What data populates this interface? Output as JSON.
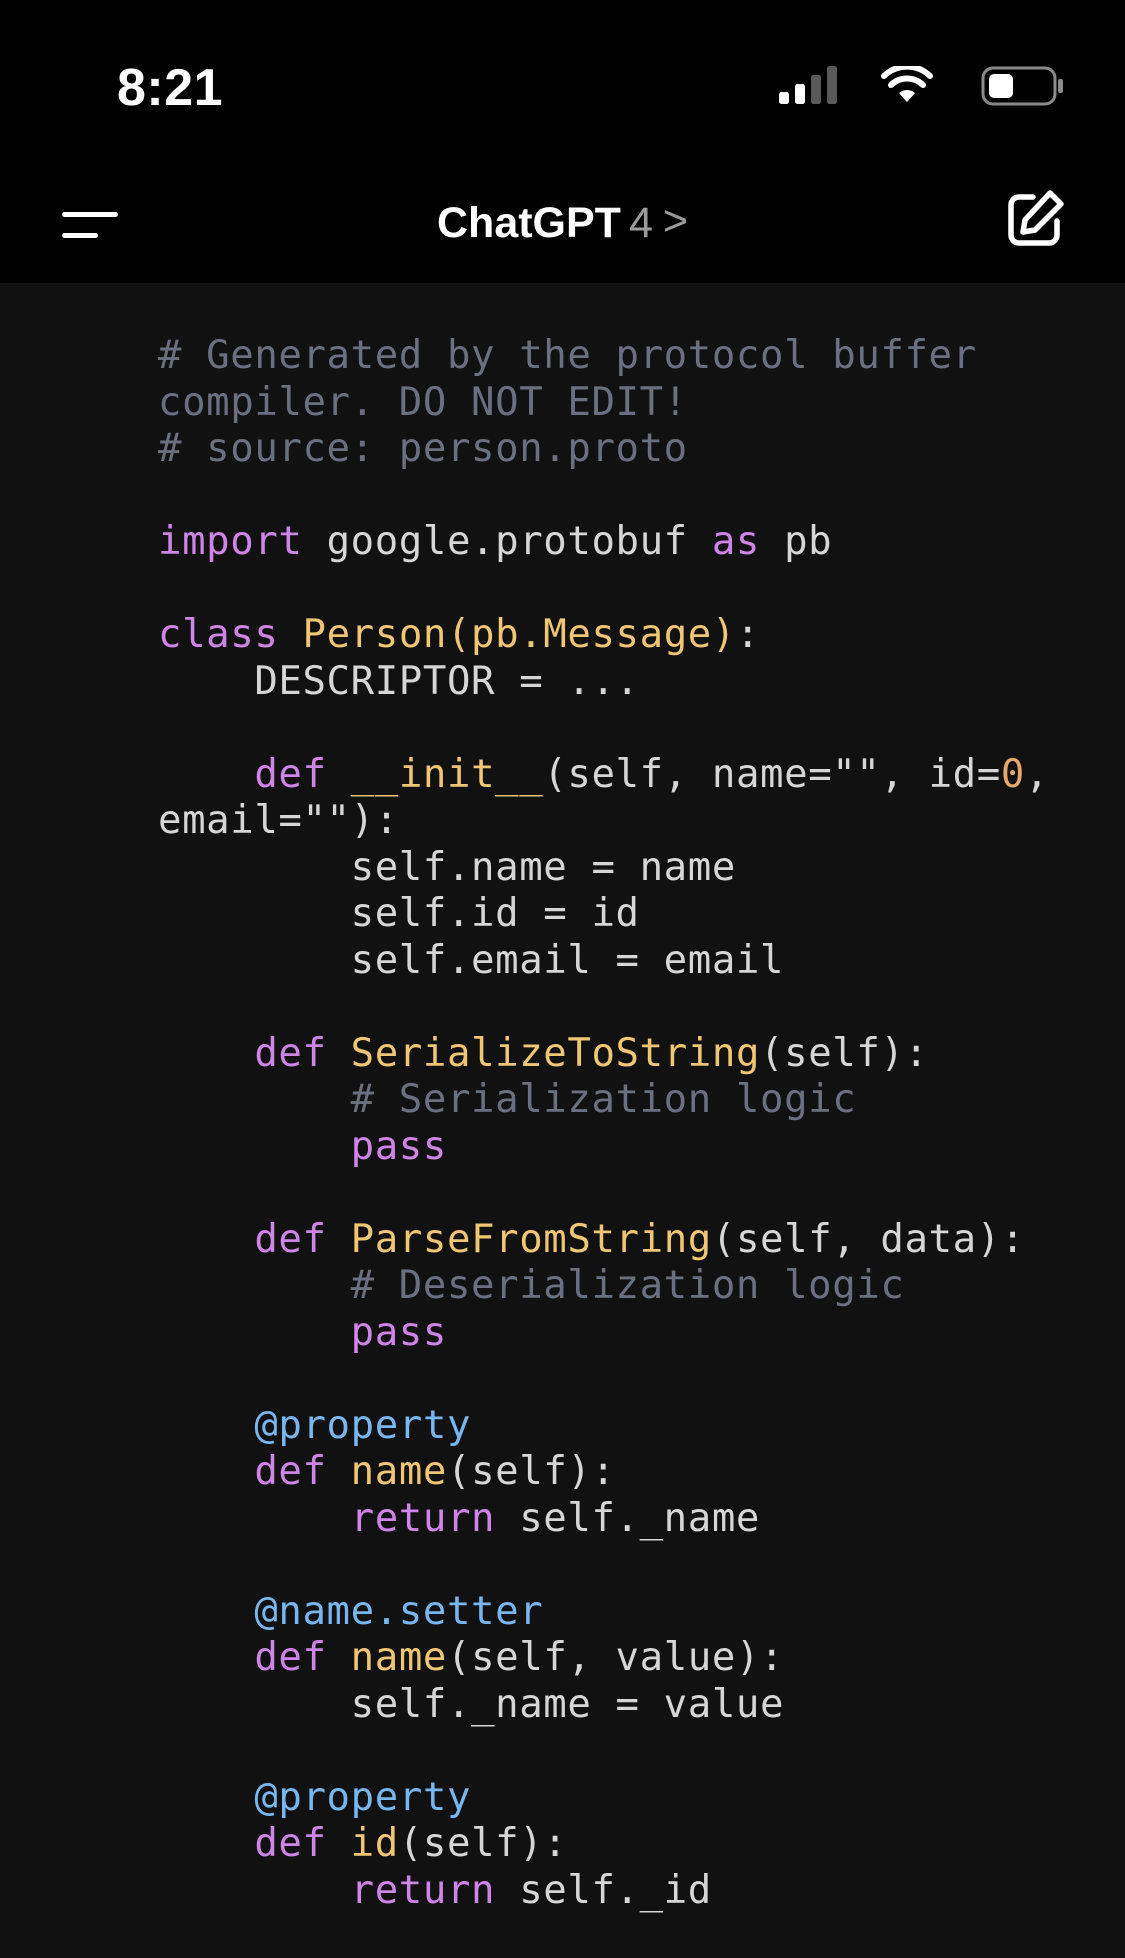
{
  "status_bar": {
    "time": "8:21",
    "icons": [
      "signal-icon",
      "wifi-icon",
      "battery-icon"
    ]
  },
  "nav": {
    "title": "ChatGPT",
    "model": "4",
    "chevron": ">",
    "icons": [
      "menu-icon",
      "new-chat-icon"
    ]
  },
  "colors": {
    "background": "#111111",
    "keyword": "#cf84e8",
    "function": "#f0c674",
    "number": "#e6a86a",
    "decorator": "#78b6f0",
    "comment": "#6b7080",
    "text": "#d6d6d6"
  },
  "code": {
    "language": "python",
    "lines": [
      "# Generated by the protocol buffer",
      "compiler. DO NOT EDIT!",
      "# source: person.proto",
      "",
      "import google.protobuf as pb",
      "",
      "class Person(pb.Message):",
      "    DESCRIPTOR = ...",
      "",
      "    def __init__(self, name=\"\", id=0,",
      "email=\"\"):",
      "        self.name = name",
      "        self.id = id",
      "        self.email = email",
      "",
      "    def SerializeToString(self):",
      "        # Serialization logic",
      "        pass",
      "",
      "    def ParseFromString(self, data):",
      "        # Deserialization logic",
      "        pass",
      "",
      "    @property",
      "    def name(self):",
      "        return self._name",
      "",
      "    @name.setter",
      "    def name(self, value):",
      "        self._name = value",
      "",
      "    @property",
      "    def id(self):",
      "        return self._id"
    ]
  }
}
